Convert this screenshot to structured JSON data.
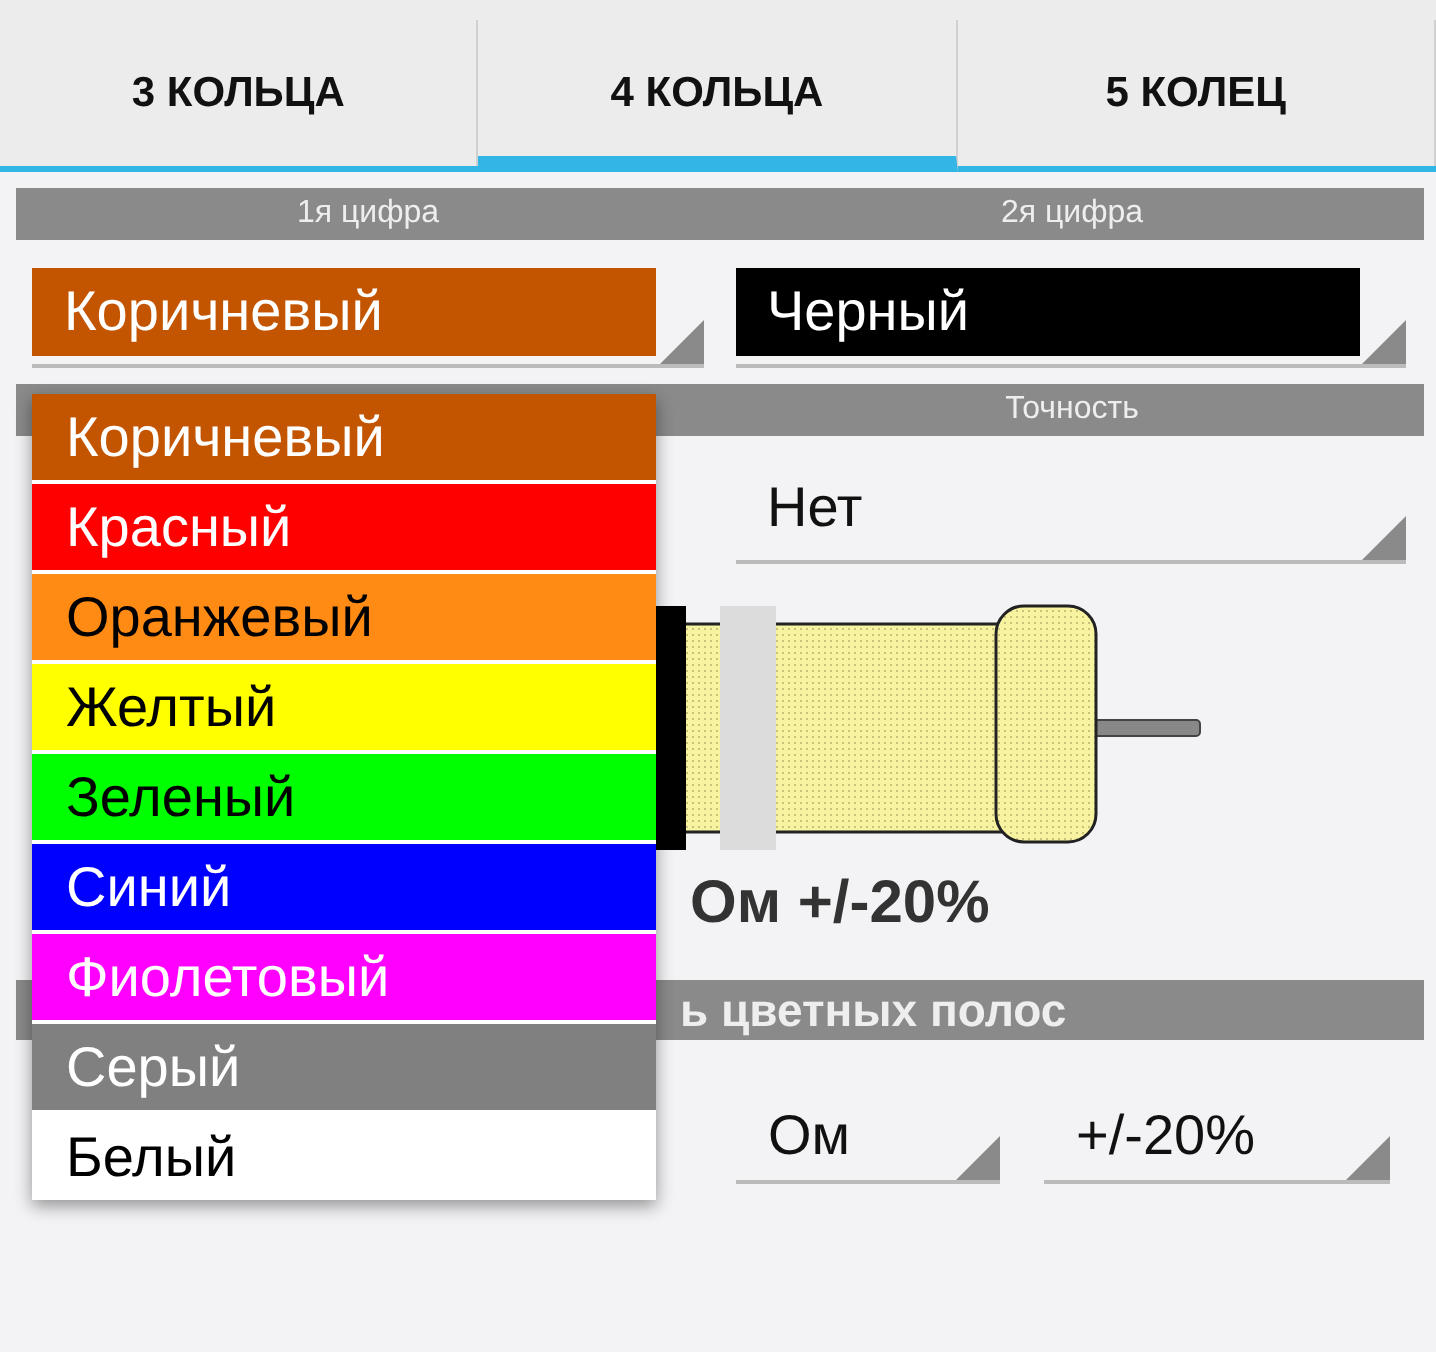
{
  "tabs": [
    {
      "label": "3 КОЛЬЦА",
      "selected": false
    },
    {
      "label": "4 КОЛЬЦА",
      "selected": true
    },
    {
      "label": "5 КОЛЕЦ",
      "selected": false
    }
  ],
  "digits": {
    "headers": [
      "1я цифра",
      "2я цифра"
    ],
    "spinners": [
      {
        "value": "Коричневый",
        "color": "#c45500"
      },
      {
        "value": "Черный",
        "color": "#000000"
      }
    ]
  },
  "accuracy": {
    "header": "Точность",
    "value": "Нет"
  },
  "result": "Ом +/-20%",
  "section_title": "ь цветных полос",
  "bottom": {
    "unit": "Ом",
    "tolerance": "+/-20%"
  },
  "dropdown": [
    {
      "label": "Коричневый",
      "color": "#c45500"
    },
    {
      "label": "Красный",
      "color": "#ff0000"
    },
    {
      "label": "Оранжевый",
      "color": "#ff8a14"
    },
    {
      "label": "Желтый",
      "color": "#ffff00"
    },
    {
      "label": "Зеленый",
      "color": "#00ff00"
    },
    {
      "label": "Синий",
      "color": "#0000ff"
    },
    {
      "label": "Фиолетовый",
      "color": "#ff00ff"
    },
    {
      "label": "Серый",
      "color": "#808080"
    },
    {
      "label": "Белый",
      "color": "#ffffff"
    }
  ]
}
